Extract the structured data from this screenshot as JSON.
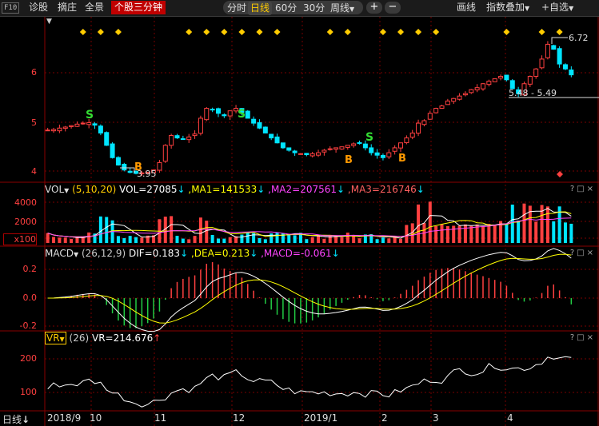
{
  "toolbar": {
    "badge": "F10",
    "left_items": [
      "诊股",
      "摘庄",
      "全景"
    ],
    "active_tab": "个股三分钟",
    "periods": [
      "分时",
      "日线",
      "60分",
      "30分"
    ],
    "active_period": "日线",
    "period_more": "周线",
    "zoom_in": "+",
    "zoom_out": "−",
    "draw": "画线",
    "indicator_overlay": "指数叠加",
    "add_watchlist": "+自选"
  },
  "price_pane": {
    "y_ticks": [
      "6",
      "5",
      "4"
    ],
    "high_label": "6.72",
    "low_label": "3.95",
    "range_label": "5.48 - 5.49",
    "signals": [
      "S",
      "B",
      "S",
      "B",
      "S",
      "B"
    ]
  },
  "vol_pane": {
    "name": "VOL",
    "params": "(5,10,20)",
    "vol": "VOL=27085",
    "ma1": ",MA1=141533",
    "ma2": ",MA2=207561",
    "ma3": ",MA3=216746",
    "y_ticks": [
      "4000",
      "2000"
    ],
    "unit": "x100"
  },
  "macd_pane": {
    "name": "MACD",
    "params": "(26,12,9)",
    "dif": "DIF=0.183",
    "dea": ",DEA=0.213",
    "macd": ",MACD=-0.061",
    "y_ticks": [
      "0.2",
      "0.0",
      "-0.2"
    ]
  },
  "vr_pane": {
    "name": "VR",
    "params": "(26)",
    "value": "VR=214.676",
    "y_ticks": [
      "200",
      "100"
    ]
  },
  "pane_controls": "?□×",
  "x_axis": {
    "period_button": "日线",
    "labels": [
      "2018/9",
      "10",
      "11",
      "12",
      "2019/1",
      "2",
      "3",
      "4"
    ]
  },
  "colors": {
    "up": "#ff4040",
    "down": "#00e5ff",
    "ma1": "#ffffff",
    "ma2": "#ffff00",
    "ma3": "#ff44ff",
    "signal": "#ffcc00",
    "grid": "#7a0000",
    "active_tab": "#c00000"
  },
  "chart_data": {
    "type": "candlestick",
    "x_range": [
      "2018-09",
      "2019-04"
    ],
    "price": {
      "ylim": [
        3.85,
        6.85
      ],
      "high": 6.72,
      "low": 3.95,
      "close_series": [
        4.86,
        4.87,
        4.9,
        4.92,
        4.95,
        4.98,
        5.0,
        5.01,
        4.96,
        4.8,
        4.55,
        4.3,
        4.15,
        4.05,
        4.0,
        3.98,
        3.99,
        4.0,
        4.05,
        4.2,
        4.55,
        4.75,
        4.7,
        4.68,
        4.72,
        4.78,
        5.1,
        5.3,
        5.28,
        5.2,
        5.15,
        5.25,
        5.3,
        5.22,
        5.1,
        5.0,
        4.9,
        4.8,
        4.7,
        4.6,
        4.5,
        4.45,
        4.4,
        4.38,
        4.36,
        4.38,
        4.4,
        4.45,
        4.48,
        4.5,
        4.52,
        4.55,
        4.58,
        4.6,
        4.5,
        4.4,
        4.35,
        4.3,
        4.4,
        4.5,
        4.6,
        4.7,
        4.8,
        5.0,
        5.05,
        5.2,
        5.3,
        5.35,
        5.45,
        5.5,
        5.55,
        5.6,
        5.68,
        5.72,
        5.8,
        5.85,
        5.9,
        5.95,
        5.88,
        5.7,
        5.6,
        5.8,
        5.95,
        6.1,
        6.3,
        6.6,
        6.5,
        6.2,
        6.1,
        5.98
      ]
    },
    "vol": {
      "ylim": [
        0,
        5000
      ],
      "unit": "x100"
    },
    "macd": {
      "ylim": [
        -0.25,
        0.25
      ]
    },
    "vr": {
      "ylim": [
        50,
        240
      ]
    }
  }
}
